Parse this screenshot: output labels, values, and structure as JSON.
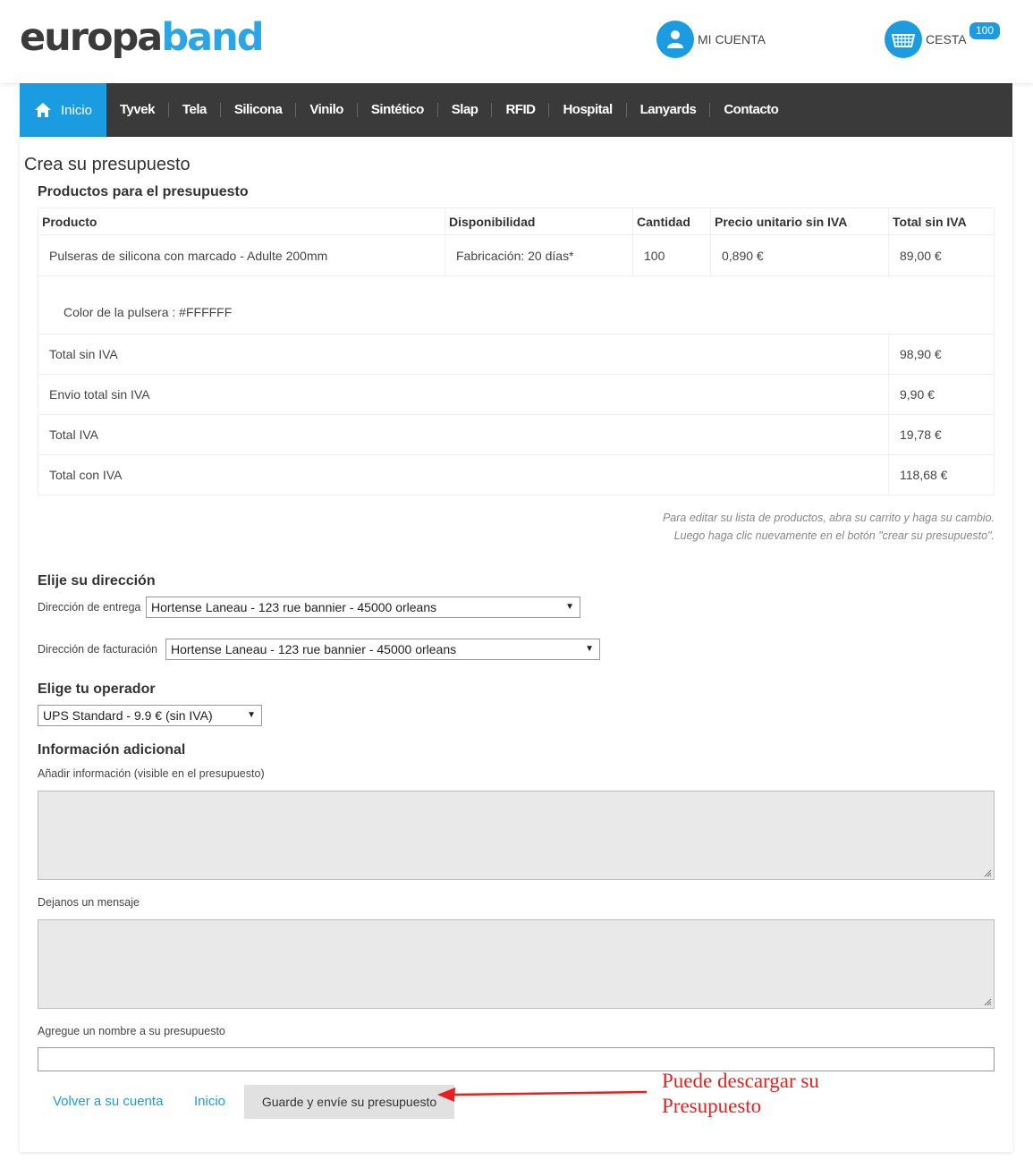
{
  "header": {
    "logo_part1": "europa",
    "logo_part2": "band",
    "account_label": "MI CUENTA",
    "cart_label": "CESTA",
    "cart_count": "100"
  },
  "nav": {
    "home_label": "Inicio",
    "items": [
      "Tyvek",
      "Tela",
      "Silicona",
      "Vinilo",
      "Sintético",
      "Slap",
      "RFID",
      "Hospital",
      "Lanyards",
      "Contacto"
    ]
  },
  "page_title": "Crea su presupuesto",
  "products_title": "Productos para el presupuesto",
  "table": {
    "headers": [
      "Producto",
      "Disponibilidad",
      "Cantidad",
      "Precio unitario sin IVA",
      "Total sin IVA"
    ],
    "row": [
      "Pulseras de silicona con marcado - Adulte 200mm",
      "Fabricación: 20 días*",
      "100",
      "0,890 €",
      "89,00 €"
    ],
    "option": "Color de la pulsera : #FFFFFF",
    "totals": [
      {
        "label": "Total sin IVA",
        "value": "98,90 €"
      },
      {
        "label": "Envio total sin IVA",
        "value": "9,90 €"
      },
      {
        "label": "Total IVA",
        "value": "19,78 €"
      },
      {
        "label": "Total con IVA",
        "value": "118,68 €"
      }
    ]
  },
  "edit_note": {
    "line1": "Para editar su lista de productos, abra su carrito y haga su cambio.",
    "line2": "Luego haga clic nuevamente en el botón \"crear su presupuesto\"."
  },
  "address": {
    "title": "Elije su dirección",
    "delivery_label": "Dirección de entrega",
    "delivery_value": "Hortense Laneau - 123 rue bannier - 45000 orleans",
    "billing_label": "Dirección de facturación",
    "billing_value": "Hortense Laneau - 123 rue bannier - 45000 orleans"
  },
  "carrier": {
    "title": "Elige tu operador",
    "value": "UPS Standard - 9.9 € (sin IVA)"
  },
  "extra": {
    "title": "Información adicional",
    "info_label": "Añadir información (visible en el presupuesto)",
    "message_label": "Dejanos un mensaje",
    "name_label": "Agregue un nombre a su presupuesto"
  },
  "actions": {
    "back_label": "Volver a su cuenta",
    "home_label": "Inicio",
    "submit_label": "Guarde y envíe su presupuesto"
  },
  "annotation": {
    "line1": "Puede descargar su",
    "line2": "Presupuesto",
    "color": "#e8201e"
  },
  "colors": {
    "accent": "#1b9be0",
    "nav_bg": "#3a3a3a"
  }
}
